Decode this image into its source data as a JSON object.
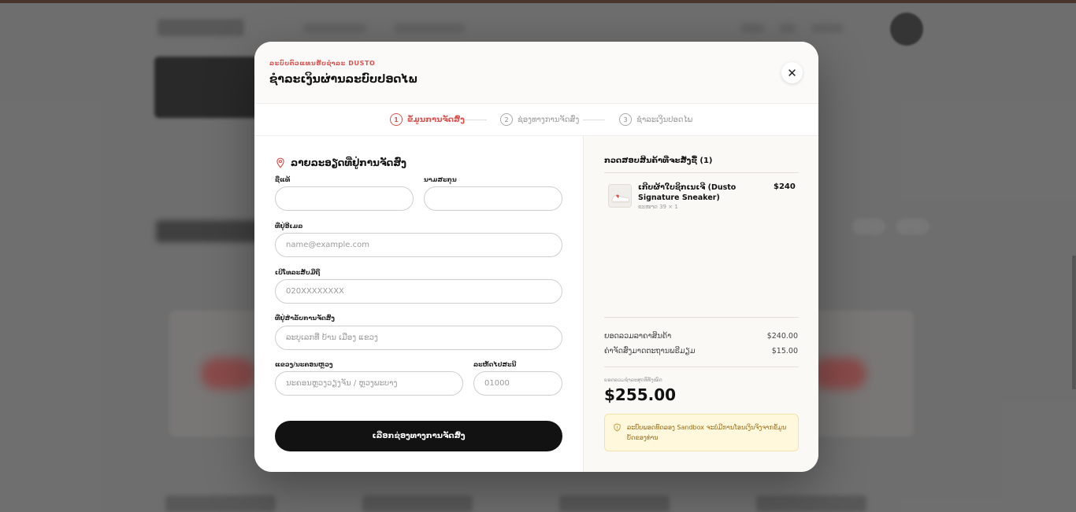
{
  "modal": {
    "eyebrow": "ລະບົບຕົວແທນຮັບຊຳລະ DUSTO",
    "title": "ຊຳລະເງິນຜ່ານລະບົບປອດໄພ",
    "close_icon": "close-icon"
  },
  "steps": [
    {
      "num": "1",
      "label": "ຂໍ້ມູນການຈັດສົ່ງ",
      "active": true
    },
    {
      "num": "2",
      "label": "ຊ່ອງທາງການຈັດສົ່ງ",
      "active": false
    },
    {
      "num": "3",
      "label": "ຊຳລະເງິນປອດໄພ",
      "active": false
    }
  ],
  "form": {
    "section_title": "ລາຍລະອຽດທີ່ຢູ່ການຈັດສົ່ງ",
    "section_icon": "map-pin-icon",
    "first_name": {
      "label": "ຊື່ແທ້",
      "value": "",
      "placeholder": ""
    },
    "last_name": {
      "label": "ນາມສະກຸນ",
      "value": "",
      "placeholder": ""
    },
    "email": {
      "label": "ທີ່ຢູ່ອີເມລ",
      "value": "",
      "placeholder": "name@example.com"
    },
    "phone": {
      "label": "ເບີໂທລະສັບມືຖື",
      "value": "",
      "placeholder": "020XXXXXXXX"
    },
    "address": {
      "label": "ທີ່ຢູ່ສຳລັບການຈັດສົ່ງ",
      "value": "",
      "placeholder": "ລະບຸເລກທີ່ ບ້ານ ເມືອງ ແຂວງ"
    },
    "province": {
      "label": "ແຂວງ/ນະຄອນຫຼວງ",
      "value": "",
      "placeholder": "ນະຄອນຫຼວງວຽງຈັນ / ຫຼວງພະບາງ"
    },
    "postal": {
      "label": "ລະຫັດໄປສະນີ",
      "value": "",
      "placeholder": "01000"
    },
    "submit_label": "ເລືອກຊ່ອງທາງການຈັດສົ່ງ"
  },
  "summary": {
    "title": "ກວດສອບສິນຄ້າທີ່ຈະສັ່ງຊື້ (1)",
    "items": [
      {
        "name": "ເກີບຜ້າໃບຊິກເນເຈີ (Dusto Signature Sneaker)",
        "price": "$240",
        "meta": "ຂະໜາດ 39 × 1"
      }
    ],
    "subtotal_label": "ຍອດລວມລາຄາສິນຄ້າ",
    "subtotal_value": "$240.00",
    "shipping_label": "ຄ່າຈັດສົ່ງມາດຕະຖານພຣີມຽມ",
    "shipping_value": "$15.00",
    "total_caption": "ຍອດລວມຊຳລະສຸດທິທັງໝົດ",
    "total_value": "$255.00",
    "notice_icon": "info-shield-icon",
    "notice": "ລະບົບພອດທົດລອງ Sandbox ຈະບໍ່ມີການໂອນເງິນຈິງຈາກຂໍ້ມູນບັດຂອງທ່ານ"
  },
  "colors": {
    "accent": "#d9534f",
    "button": "#121212",
    "summary_bg": "#faf9f6",
    "notice_bg": "#fff8dc"
  }
}
